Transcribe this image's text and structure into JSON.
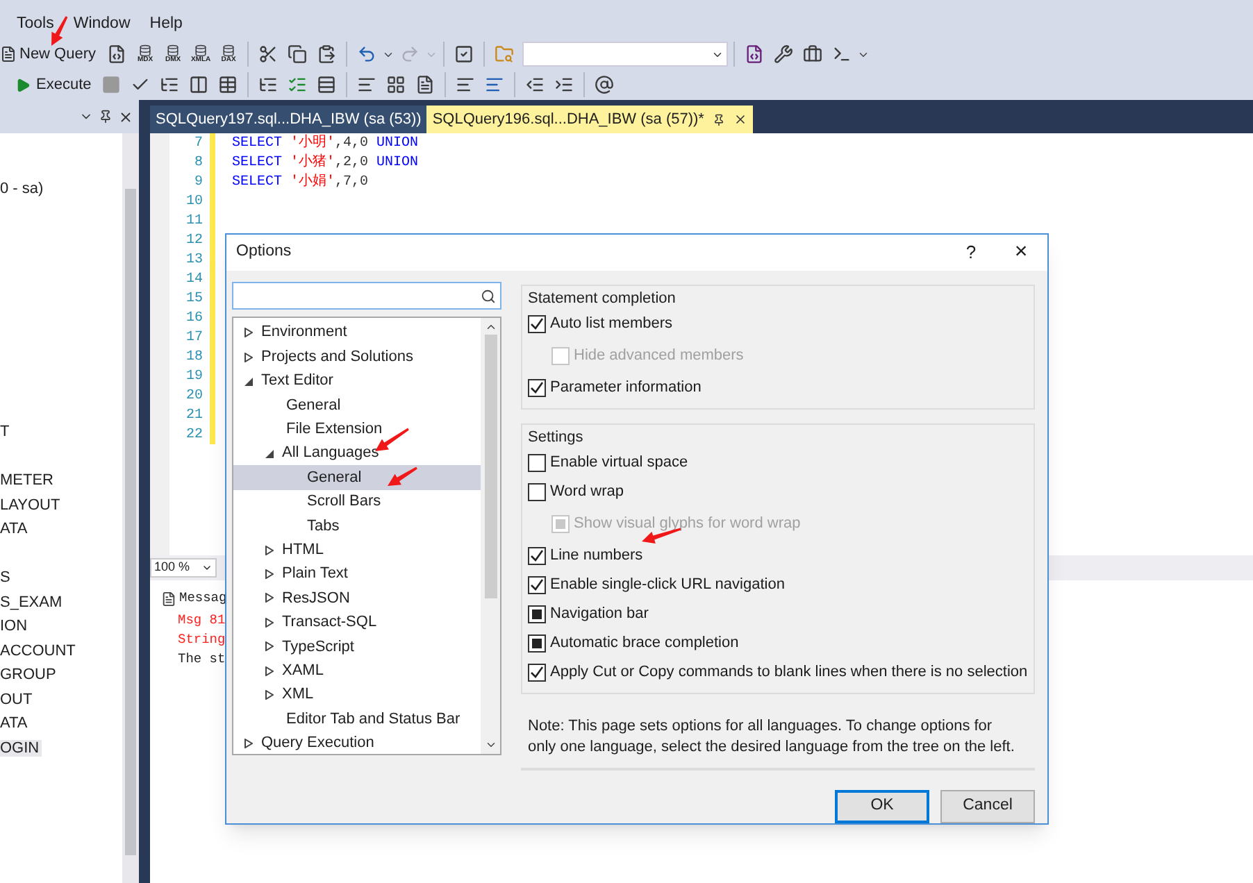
{
  "menu": [
    "Tools",
    "Window",
    "Help"
  ],
  "toolbar": {
    "new_query": "New Query",
    "query_types": [
      "MDX",
      "DMX",
      "XMLA",
      "DAX"
    ],
    "execute": "Execute"
  },
  "panel": {
    "items": [
      {
        "text": "0 - sa)",
        "selected": false
      },
      {
        "text": "T",
        "selected": false
      },
      {
        "text": "METER",
        "selected": false
      },
      {
        "text": "LAYOUT",
        "selected": false
      },
      {
        "text": "ATA",
        "selected": false
      },
      {
        "text": "S",
        "selected": false
      },
      {
        "text": "S_EXAM",
        "selected": false
      },
      {
        "text": "ION",
        "selected": false
      },
      {
        "text": "ACCOUNT",
        "selected": false
      },
      {
        "text": "GROUP",
        "selected": false
      },
      {
        "text": "OUT",
        "selected": false
      },
      {
        "text": "ATA",
        "selected": false
      },
      {
        "text": "OGIN",
        "selected": true
      }
    ]
  },
  "tabs": [
    {
      "label": "SQLQuery197.sql...DHA_IBW (sa (53))",
      "selected": false
    },
    {
      "label": "SQLQuery196.sql...DHA_IBW (sa (57))*",
      "selected": true
    }
  ],
  "editor": {
    "line_numbers": [
      "7",
      "8",
      "9",
      "10",
      "11",
      "12",
      "13",
      "14",
      "15",
      "16",
      "17",
      "18",
      "19",
      "20",
      "21",
      "22"
    ],
    "lines": [
      [
        {
          "kind": "keyword",
          "text": "SELECT "
        },
        {
          "kind": "string",
          "text": "'小明'"
        },
        {
          "kind": "plain",
          "text": ",4,0 "
        },
        {
          "kind": "keyword",
          "text": "UNION"
        }
      ],
      [
        {
          "kind": "keyword",
          "text": "SELECT "
        },
        {
          "kind": "string",
          "text": "'小猪'"
        },
        {
          "kind": "plain",
          "text": ",2,0 "
        },
        {
          "kind": "keyword",
          "text": "UNION"
        }
      ],
      [
        {
          "kind": "keyword",
          "text": "SELECT "
        },
        {
          "kind": "string",
          "text": "'小娟'"
        },
        {
          "kind": "plain",
          "text": ",7,0"
        }
      ]
    ],
    "zoom": "100 %"
  },
  "messages": {
    "tab": "Messag",
    "lines": [
      {
        "kind": "error",
        "text": "Msg 81"
      },
      {
        "kind": "error",
        "text": "String"
      },
      {
        "kind": "info",
        "text": "The st"
      }
    ]
  },
  "dialog": {
    "title": "Options",
    "help": "?",
    "close": "×",
    "tree": [
      {
        "kind": "node",
        "label": "Environment",
        "expanded": false,
        "selected": false
      },
      {
        "kind": "node",
        "label": "Projects and Solutions",
        "expanded": false,
        "selected": false
      },
      {
        "kind": "node",
        "label": "Text Editor",
        "expanded": true,
        "selected": false,
        "children": [
          {
            "kind": "leaf",
            "label": "General",
            "selected": false
          },
          {
            "kind": "leaf",
            "label": "File Extension",
            "selected": false
          },
          {
            "kind": "node",
            "label": "All Languages",
            "expanded": true,
            "selected": false,
            "children": [
              {
                "kind": "leaf",
                "label": "General",
                "selected": true
              },
              {
                "kind": "leaf",
                "label": "Scroll Bars",
                "selected": false
              },
              {
                "kind": "leaf",
                "label": "Tabs",
                "selected": false
              }
            ]
          },
          {
            "kind": "node",
            "label": "HTML",
            "expanded": false,
            "selected": false
          },
          {
            "kind": "node",
            "label": "Plain Text",
            "expanded": false,
            "selected": false
          },
          {
            "kind": "node",
            "label": "ResJSON",
            "expanded": false,
            "selected": false
          },
          {
            "kind": "node",
            "label": "Transact-SQL",
            "expanded": false,
            "selected": false
          },
          {
            "kind": "node",
            "label": "TypeScript",
            "expanded": false,
            "selected": false
          },
          {
            "kind": "node",
            "label": "XAML",
            "expanded": false,
            "selected": false
          },
          {
            "kind": "node",
            "label": "XML",
            "expanded": false,
            "selected": false
          },
          {
            "kind": "leaf",
            "label": "Editor Tab and Status Bar",
            "selected": false
          }
        ]
      },
      {
        "kind": "node",
        "label": "Query Execution",
        "expanded": false,
        "selected": false
      }
    ],
    "groups": [
      {
        "title": "Statement completion",
        "options": [
          {
            "label": "Auto list members",
            "kind": "checked",
            "disabled": false,
            "children": [
              {
                "label": "Hide advanced members",
                "kind": "unchecked",
                "disabled": true
              }
            ]
          },
          {
            "label": "Parameter information",
            "kind": "checked",
            "disabled": false
          }
        ]
      },
      {
        "title": "Settings",
        "options": [
          {
            "label": "Enable virtual space",
            "kind": "unchecked",
            "disabled": false
          },
          {
            "label": "Word wrap",
            "kind": "unchecked",
            "disabled": false,
            "children": [
              {
                "label": "Show visual glyphs for word wrap",
                "kind": "mixed",
                "disabled": true
              }
            ]
          },
          {
            "label": "Line numbers",
            "kind": "checked",
            "disabled": false
          },
          {
            "label": "Enable single-click URL navigation",
            "kind": "checked",
            "disabled": false
          },
          {
            "label": "Navigation bar",
            "kind": "mixed",
            "disabled": false
          },
          {
            "label": "Automatic brace completion",
            "kind": "mixed",
            "disabled": false
          },
          {
            "label": "Apply Cut or Copy commands to blank lines when there is no selection",
            "kind": "checked",
            "disabled": false
          }
        ]
      }
    ],
    "note": "Note: This page sets options for all languages. To change options for only one language, select the desired language from the tree on the left.",
    "buttons": [
      {
        "label": "OK",
        "default": true
      },
      {
        "label": "Cancel",
        "default": false
      }
    ]
  }
}
